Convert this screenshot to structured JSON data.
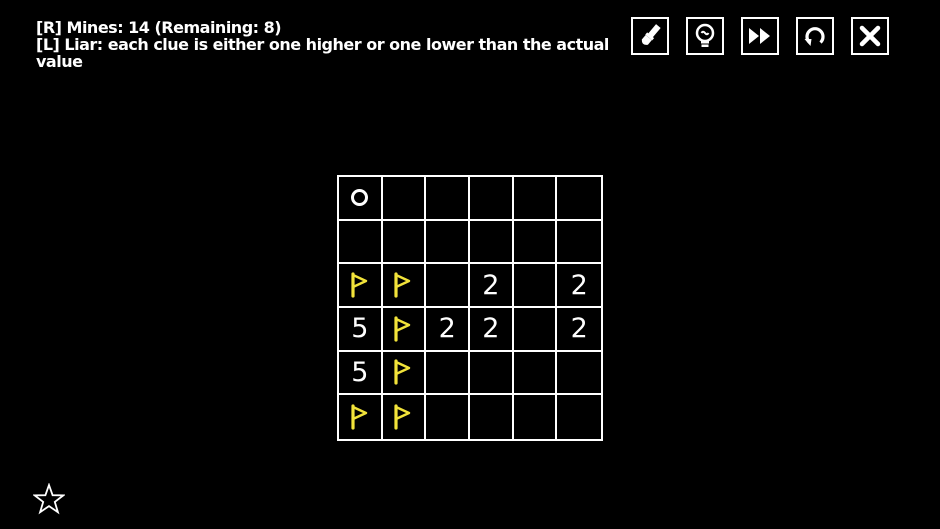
{
  "rules": {
    "line1": "[R] Mines: 14 (Remaining: 8)",
    "line2": "[L] Liar: each clue is either one higher or one lower than the actual value"
  },
  "toolbar": [
    {
      "name": "brush-button",
      "icon": "paintbrush-icon"
    },
    {
      "name": "hint-button",
      "icon": "lightbulb-icon"
    },
    {
      "name": "skip-button",
      "icon": "fast-forward-icon"
    },
    {
      "name": "restart-button",
      "icon": "refresh-icon"
    },
    {
      "name": "close-button",
      "icon": "close-icon"
    }
  ],
  "board": {
    "rows": 6,
    "cols": 6,
    "cells": [
      [
        "circle",
        "",
        "",
        "",
        "",
        ""
      ],
      [
        "",
        "",
        "",
        "",
        "",
        ""
      ],
      [
        "flag",
        "flag",
        "",
        "2",
        "",
        "2"
      ],
      [
        "5",
        "flag",
        "2",
        "2",
        "",
        "2"
      ],
      [
        "5",
        "flag",
        "",
        "",
        "",
        ""
      ],
      [
        "flag",
        "flag",
        "",
        "",
        "",
        ""
      ]
    ]
  },
  "colors": {
    "background": "#000000",
    "grid": "#ffffff",
    "flag": "#f2e33a",
    "text": "#ffffff"
  },
  "footer": {
    "icon": "star-icon"
  }
}
